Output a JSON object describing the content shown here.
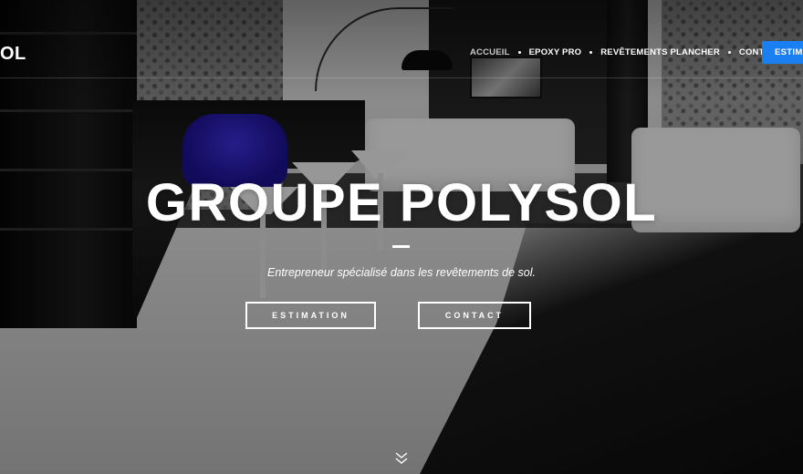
{
  "header": {
    "brand": "OL",
    "nav": [
      {
        "label": "ACCUEIL",
        "active": true
      },
      {
        "label": "EPOXY PRO",
        "active": false
      },
      {
        "label": "REVÊTEMENTS PLANCHER",
        "active": false
      },
      {
        "label": "CONTACT",
        "active": false
      }
    ],
    "cta_label": "ESTIMA"
  },
  "hero": {
    "title": "GROUPE POLYSOL",
    "subtitle": "Entrepreneur spécialisé dans les revêtements de sol.",
    "buttons": [
      {
        "label": "ESTIMATION"
      },
      {
        "label": "CONTACT"
      }
    ]
  },
  "icons": {
    "scroll": "chevron-double-down-icon"
  },
  "colors": {
    "accent": "#1a7ff0",
    "text": "#ffffff"
  }
}
